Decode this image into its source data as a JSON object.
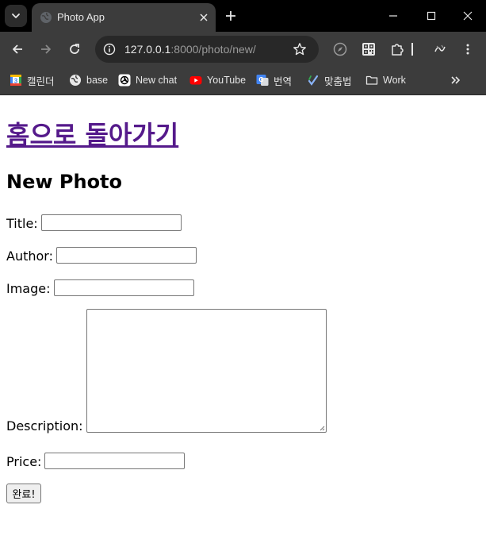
{
  "browser": {
    "tab": {
      "title": "Photo App"
    },
    "url": {
      "host": "127.0.0.1",
      "path": ":8000/photo/new/"
    },
    "bookmarks": [
      {
        "label": "캘린더",
        "icon": "calendar-icon"
      },
      {
        "label": "base",
        "icon": "globe-icon"
      },
      {
        "label": "New chat",
        "icon": "openai-icon"
      },
      {
        "label": "YouTube",
        "icon": "youtube-icon"
      },
      {
        "label": "번역",
        "icon": "translate-icon"
      },
      {
        "label": "맞춤법",
        "icon": "spellcheck-icon"
      },
      {
        "label": "Work",
        "icon": "folder-icon"
      }
    ],
    "colors": {
      "tabstrip": "#000000",
      "toolbar": "#3c3c3c",
      "omnibox": "#282828"
    }
  },
  "page": {
    "home_link": "홈으로 돌아가기",
    "title": "New Photo",
    "form": {
      "title_label": "Title:",
      "author_label": "Author:",
      "image_label": "Image:",
      "description_label": "Description:",
      "price_label": "Price:",
      "submit_label": "완료!"
    },
    "colors": {
      "link": "#551a8b"
    }
  }
}
